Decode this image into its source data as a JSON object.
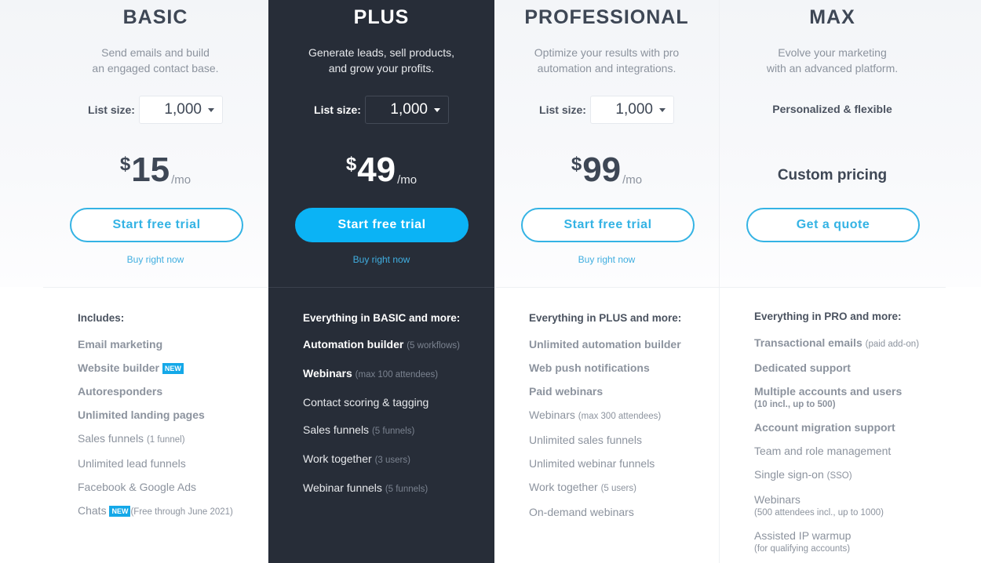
{
  "colors": {
    "accent": "#34b3e4",
    "accent_filled": "#0bb3f5",
    "dark_column": "#272d38",
    "heading_text": "#3e4755",
    "muted_text": "#8c939e",
    "badge": "#14a8e8"
  },
  "plans": [
    {
      "name": "BASIC",
      "description_lines": [
        "Send emails and build",
        "an engaged contact base."
      ],
      "list_size_label": "List size:",
      "list_size_value": "1,000",
      "price_currency": "$",
      "price_amount": "15",
      "price_period": "/mo",
      "cta_label": "Start free trial",
      "buy_now_label": "Buy right now",
      "features_heading": "Includes:",
      "features": [
        {
          "text": "Email marketing",
          "bold": true
        },
        {
          "text": "Website builder",
          "bold": true,
          "badge": "NEW"
        },
        {
          "text": "Autoresponders",
          "bold": true
        },
        {
          "text": "Unlimited landing pages",
          "bold": true
        },
        {
          "text": "Sales funnels",
          "note": "(1 funnel)"
        },
        {
          "text": "Unlimited lead funnels"
        },
        {
          "text": "Facebook & Google Ads"
        },
        {
          "text": "Chats",
          "badge": "NEW",
          "note": "(Free through June 2021)"
        }
      ]
    },
    {
      "name": "PLUS",
      "description_lines": [
        "Generate leads, sell products,",
        "and grow your profits."
      ],
      "list_size_label": "List size:",
      "list_size_value": "1,000",
      "price_currency": "$",
      "price_amount": "49",
      "price_period": "/mo",
      "cta_label": "Start free trial",
      "buy_now_label": "Buy right now",
      "features_heading": "Everything in BASIC and more:",
      "features": [
        {
          "text": "Automation builder",
          "bold": true,
          "note": "(5 workflows)"
        },
        {
          "text": "Webinars",
          "bold": true,
          "note": "(max 100 attendees)"
        },
        {
          "text": "Contact scoring & tagging"
        },
        {
          "text": "Sales funnels",
          "note": "(5 funnels)"
        },
        {
          "text": "Work together",
          "note": "(3 users)"
        },
        {
          "text": "Webinar funnels",
          "note": "(5 funnels)"
        }
      ]
    },
    {
      "name": "PROFESSIONAL",
      "description_lines": [
        "Optimize your results with pro",
        "automation and integrations."
      ],
      "list_size_label": "List size:",
      "list_size_value": "1,000",
      "price_currency": "$",
      "price_amount": "99",
      "price_period": "/mo",
      "cta_label": "Start free trial",
      "buy_now_label": "Buy right now",
      "features_heading": "Everything in PLUS and more:",
      "features": [
        {
          "text": "Unlimited automation builder",
          "bold": true
        },
        {
          "text": "Web push notifications",
          "bold": true
        },
        {
          "text": "Paid webinars",
          "bold": true
        },
        {
          "text": "Webinars",
          "note": "(max 300 attendees)"
        },
        {
          "text": "Unlimited sales funnels"
        },
        {
          "text": "Unlimited webinar funnels"
        },
        {
          "text": "Work together",
          "note": "(5 users)"
        },
        {
          "text": "On-demand webinars"
        }
      ]
    },
    {
      "name": "MAX",
      "description_lines": [
        "Evolve your marketing",
        "with an advanced platform."
      ],
      "tagline": "Personalized & flexible",
      "custom_pricing": "Custom pricing",
      "cta_label": "Get a quote",
      "features_heading": "Everything in PRO and more:",
      "features": [
        {
          "text": "Transactional emails",
          "bold": true,
          "note": "(paid add-on)"
        },
        {
          "text": "Dedicated support",
          "bold": true
        },
        {
          "text": "Multiple accounts and users",
          "bold": true,
          "subnote": "(10 incl., up to 500)"
        },
        {
          "text": "Account migration support",
          "bold": true
        },
        {
          "text": "Team and role management"
        },
        {
          "text": "Single sign-on",
          "note": "(SSO)"
        },
        {
          "text": "Webinars",
          "subnote": "(500 attendees incl., up to 1000)"
        },
        {
          "text": "Assisted IP warmup",
          "subnote": "(for qualifying accounts)"
        }
      ]
    }
  ]
}
